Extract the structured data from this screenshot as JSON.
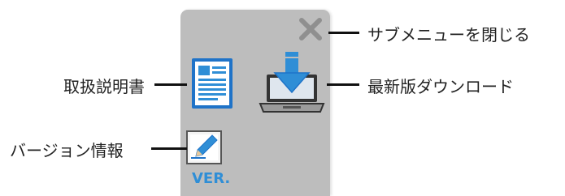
{
  "panel": {
    "ver_label": "VER."
  },
  "callouts": {
    "close": "サブメニューを閉じる",
    "download": "最新版ダウンロード",
    "manual": "取扱説明書",
    "version": "バージョン情報"
  },
  "icons": {
    "close": "close-icon",
    "manual": "document-icon",
    "download": "laptop-download-icon",
    "version": "pencil-edit-icon"
  },
  "colors": {
    "panel_bg": "#bdbdbd",
    "accent_blue": "#2f8ed6",
    "close_grey": "#8f8f8f"
  }
}
